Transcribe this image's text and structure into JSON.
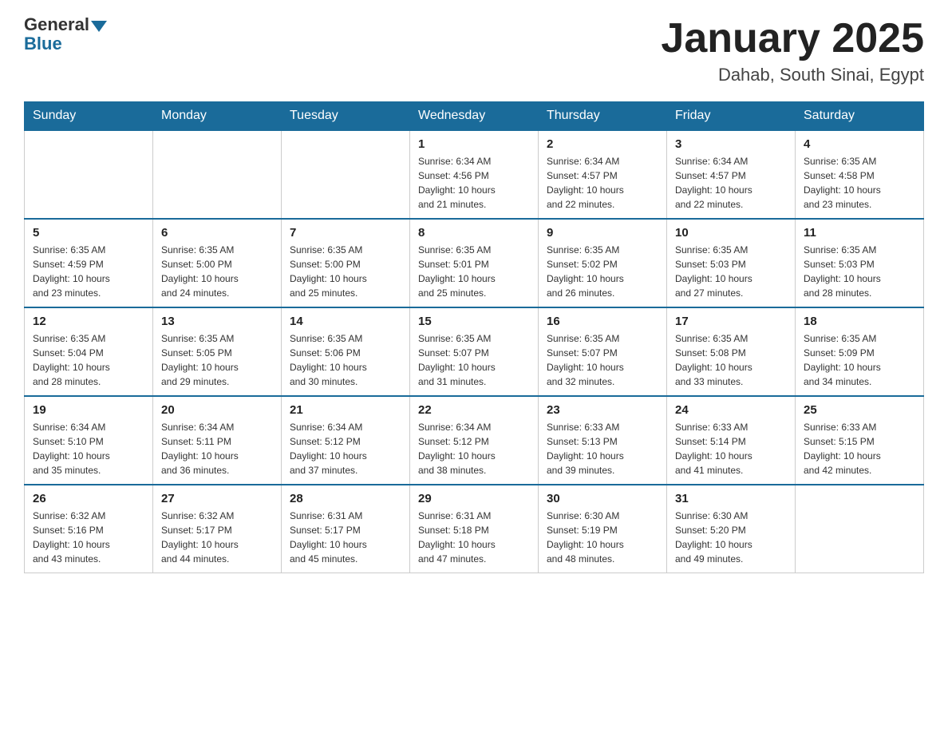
{
  "header": {
    "logo_general": "General",
    "logo_blue": "Blue",
    "month_title": "January 2025",
    "location": "Dahab, South Sinai, Egypt"
  },
  "days_of_week": [
    "Sunday",
    "Monday",
    "Tuesday",
    "Wednesday",
    "Thursday",
    "Friday",
    "Saturday"
  ],
  "weeks": [
    [
      {
        "day": "",
        "info": ""
      },
      {
        "day": "",
        "info": ""
      },
      {
        "day": "",
        "info": ""
      },
      {
        "day": "1",
        "info": "Sunrise: 6:34 AM\nSunset: 4:56 PM\nDaylight: 10 hours\nand 21 minutes."
      },
      {
        "day": "2",
        "info": "Sunrise: 6:34 AM\nSunset: 4:57 PM\nDaylight: 10 hours\nand 22 minutes."
      },
      {
        "day": "3",
        "info": "Sunrise: 6:34 AM\nSunset: 4:57 PM\nDaylight: 10 hours\nand 22 minutes."
      },
      {
        "day": "4",
        "info": "Sunrise: 6:35 AM\nSunset: 4:58 PM\nDaylight: 10 hours\nand 23 minutes."
      }
    ],
    [
      {
        "day": "5",
        "info": "Sunrise: 6:35 AM\nSunset: 4:59 PM\nDaylight: 10 hours\nand 23 minutes."
      },
      {
        "day": "6",
        "info": "Sunrise: 6:35 AM\nSunset: 5:00 PM\nDaylight: 10 hours\nand 24 minutes."
      },
      {
        "day": "7",
        "info": "Sunrise: 6:35 AM\nSunset: 5:00 PM\nDaylight: 10 hours\nand 25 minutes."
      },
      {
        "day": "8",
        "info": "Sunrise: 6:35 AM\nSunset: 5:01 PM\nDaylight: 10 hours\nand 25 minutes."
      },
      {
        "day": "9",
        "info": "Sunrise: 6:35 AM\nSunset: 5:02 PM\nDaylight: 10 hours\nand 26 minutes."
      },
      {
        "day": "10",
        "info": "Sunrise: 6:35 AM\nSunset: 5:03 PM\nDaylight: 10 hours\nand 27 minutes."
      },
      {
        "day": "11",
        "info": "Sunrise: 6:35 AM\nSunset: 5:03 PM\nDaylight: 10 hours\nand 28 minutes."
      }
    ],
    [
      {
        "day": "12",
        "info": "Sunrise: 6:35 AM\nSunset: 5:04 PM\nDaylight: 10 hours\nand 28 minutes."
      },
      {
        "day": "13",
        "info": "Sunrise: 6:35 AM\nSunset: 5:05 PM\nDaylight: 10 hours\nand 29 minutes."
      },
      {
        "day": "14",
        "info": "Sunrise: 6:35 AM\nSunset: 5:06 PM\nDaylight: 10 hours\nand 30 minutes."
      },
      {
        "day": "15",
        "info": "Sunrise: 6:35 AM\nSunset: 5:07 PM\nDaylight: 10 hours\nand 31 minutes."
      },
      {
        "day": "16",
        "info": "Sunrise: 6:35 AM\nSunset: 5:07 PM\nDaylight: 10 hours\nand 32 minutes."
      },
      {
        "day": "17",
        "info": "Sunrise: 6:35 AM\nSunset: 5:08 PM\nDaylight: 10 hours\nand 33 minutes."
      },
      {
        "day": "18",
        "info": "Sunrise: 6:35 AM\nSunset: 5:09 PM\nDaylight: 10 hours\nand 34 minutes."
      }
    ],
    [
      {
        "day": "19",
        "info": "Sunrise: 6:34 AM\nSunset: 5:10 PM\nDaylight: 10 hours\nand 35 minutes."
      },
      {
        "day": "20",
        "info": "Sunrise: 6:34 AM\nSunset: 5:11 PM\nDaylight: 10 hours\nand 36 minutes."
      },
      {
        "day": "21",
        "info": "Sunrise: 6:34 AM\nSunset: 5:12 PM\nDaylight: 10 hours\nand 37 minutes."
      },
      {
        "day": "22",
        "info": "Sunrise: 6:34 AM\nSunset: 5:12 PM\nDaylight: 10 hours\nand 38 minutes."
      },
      {
        "day": "23",
        "info": "Sunrise: 6:33 AM\nSunset: 5:13 PM\nDaylight: 10 hours\nand 39 minutes."
      },
      {
        "day": "24",
        "info": "Sunrise: 6:33 AM\nSunset: 5:14 PM\nDaylight: 10 hours\nand 41 minutes."
      },
      {
        "day": "25",
        "info": "Sunrise: 6:33 AM\nSunset: 5:15 PM\nDaylight: 10 hours\nand 42 minutes."
      }
    ],
    [
      {
        "day": "26",
        "info": "Sunrise: 6:32 AM\nSunset: 5:16 PM\nDaylight: 10 hours\nand 43 minutes."
      },
      {
        "day": "27",
        "info": "Sunrise: 6:32 AM\nSunset: 5:17 PM\nDaylight: 10 hours\nand 44 minutes."
      },
      {
        "day": "28",
        "info": "Sunrise: 6:31 AM\nSunset: 5:17 PM\nDaylight: 10 hours\nand 45 minutes."
      },
      {
        "day": "29",
        "info": "Sunrise: 6:31 AM\nSunset: 5:18 PM\nDaylight: 10 hours\nand 47 minutes."
      },
      {
        "day": "30",
        "info": "Sunrise: 6:30 AM\nSunset: 5:19 PM\nDaylight: 10 hours\nand 48 minutes."
      },
      {
        "day": "31",
        "info": "Sunrise: 6:30 AM\nSunset: 5:20 PM\nDaylight: 10 hours\nand 49 minutes."
      },
      {
        "day": "",
        "info": ""
      }
    ]
  ]
}
